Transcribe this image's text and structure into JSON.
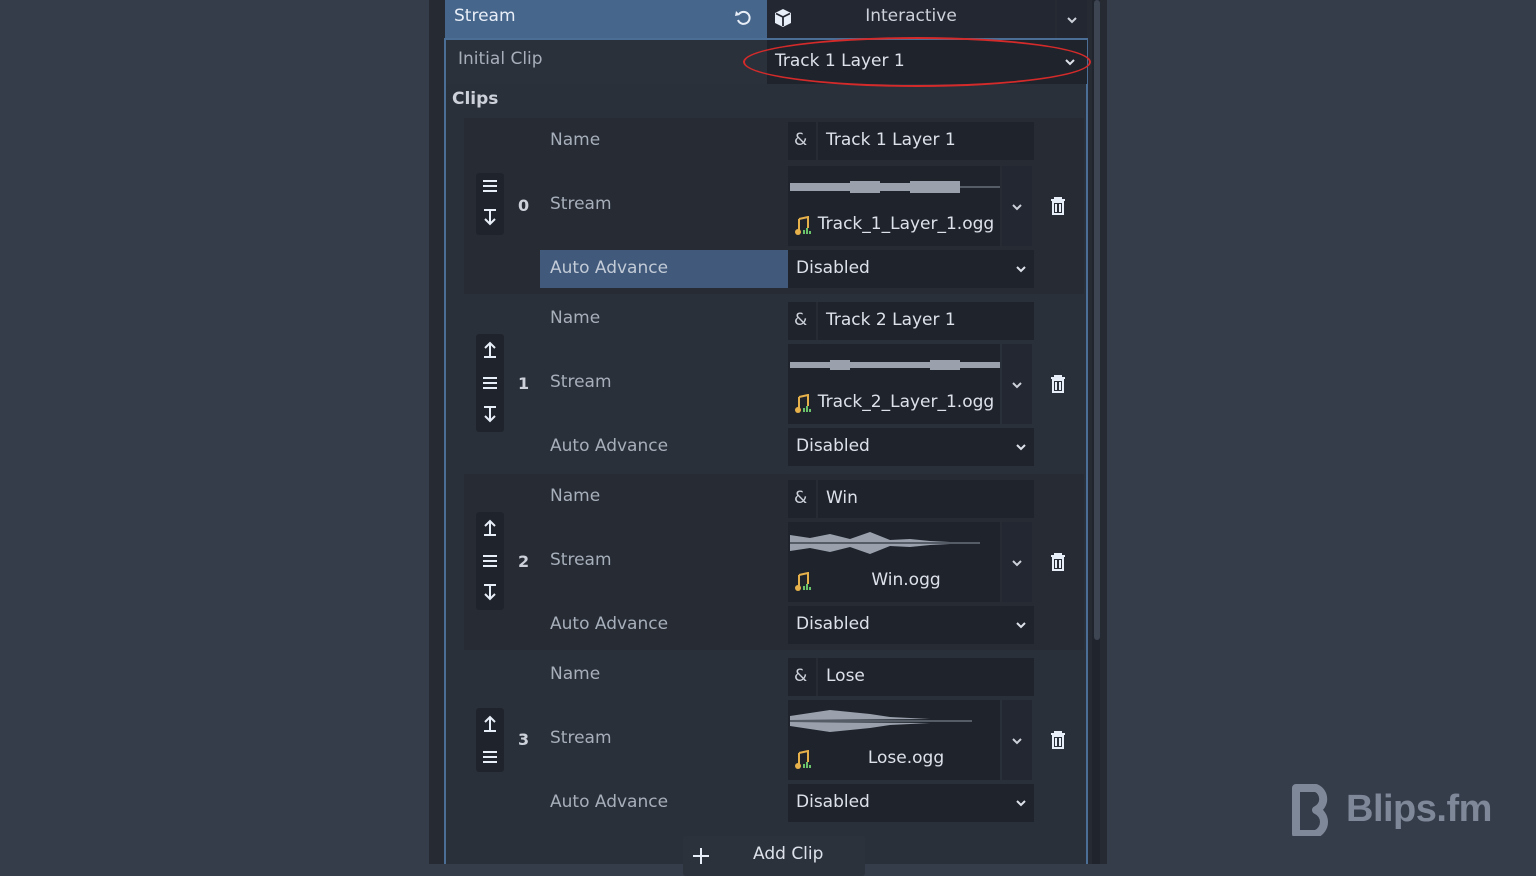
{
  "header": {
    "property_label": "Stream",
    "resource_type": "Interactive",
    "icons": {
      "revert": "revert-icon",
      "resource": "cube-icon",
      "dropdown": "chevron-down-icon"
    }
  },
  "initial_clip": {
    "label": "Initial Clip",
    "value": "Track 1 Layer 1",
    "highlighted": true
  },
  "clips": {
    "section_label": "Clips",
    "labels": {
      "name": "Name",
      "stream": "Stream",
      "auto_advance": "Auto Advance"
    },
    "name_prefix": "&",
    "items": [
      {
        "index": "0",
        "name": "Track 1 Layer 1",
        "stream_file": "Track_1_Layer_1.ogg",
        "auto_advance": "Disabled"
      },
      {
        "index": "1",
        "name": "Track 2 Layer 1",
        "stream_file": "Track_2_Layer_1.ogg",
        "auto_advance": "Disabled"
      },
      {
        "index": "2",
        "name": "Win",
        "stream_file": "Win.ogg",
        "auto_advance": "Disabled"
      },
      {
        "index": "3",
        "name": "Lose",
        "stream_file": "Lose.ogg",
        "auto_advance": "Disabled"
      }
    ],
    "add_button": "Add Clip"
  },
  "brand": {
    "name": "Blips.fm"
  },
  "colors": {
    "accent": "#46668c",
    "highlight_ring": "#d42a2a",
    "background": "#363d4a"
  }
}
